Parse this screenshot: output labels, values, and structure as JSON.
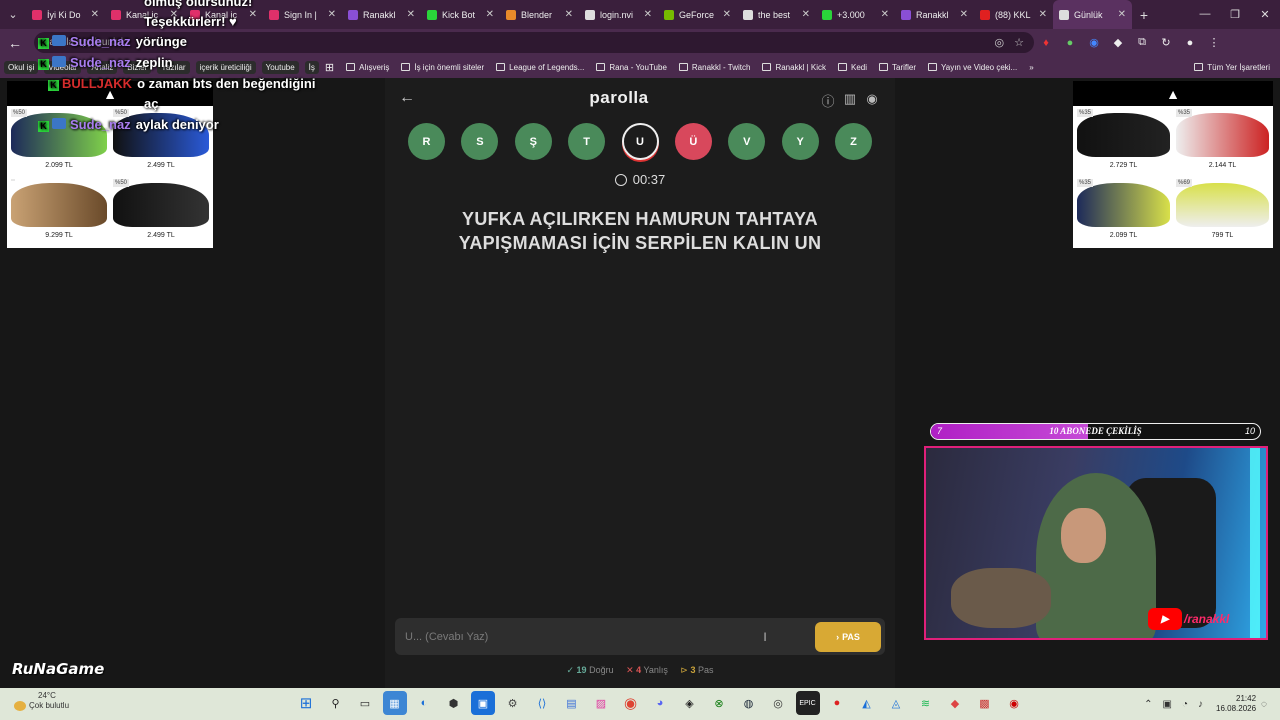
{
  "browser": {
    "tabs": [
      {
        "label": "İyi Ki Do",
        "color": "#e0306a"
      },
      {
        "label": "Kanal iç",
        "color": "#e0306a"
      },
      {
        "label": "Kanal iç",
        "color": "#e0306a"
      },
      {
        "label": "Sign In |",
        "color": "#e0306a"
      },
      {
        "label": "Ranakkl",
        "color": "#8a4fd6"
      },
      {
        "label": "Kick Bot",
        "color": "#2ad43a"
      },
      {
        "label": "Blender",
        "color": "#e88a2a"
      },
      {
        "label": "login.nvi",
        "color": "#dddddd"
      },
      {
        "label": "GeForce",
        "color": "#76b900"
      },
      {
        "label": "the best",
        "color": "#dddddd"
      },
      {
        "label": "+3.000",
        "color": "#2ad43a"
      },
      {
        "label": "Ranakkl",
        "color": "#8a4fd6"
      },
      {
        "label": "(88) KKL",
        "color": "#e02020"
      },
      {
        "label": "Günlük",
        "color": "#dddddd"
      }
    ],
    "address_url": "parolla.app/gunluk",
    "bookmarks_pills": [
      "Okul işi",
      "Videolar",
      "Analiz",
      "Bizler",
      "Yazılar",
      "içerik üreticiliği",
      "Youtube",
      "İş"
    ],
    "bookmarks": [
      "Alışveriş",
      "İş için önemli siteler",
      "League of Legends...",
      "Rana - YouTube",
      "Ranakkl - Twitch",
      "Ranakkl | Kick",
      "Kedi",
      "Tarifler",
      "Yayın ve Video çeki..."
    ],
    "all_bookmarks": "Tüm Yer İşaretleri"
  },
  "chat": [
    {
      "user": "",
      "text": "olmuş olursunuz!"
    },
    {
      "user": "",
      "text": "Teşekkürlerr! ♥"
    },
    {
      "user": "Sude_naz",
      "text": "yörünge"
    },
    {
      "user": "Sude_naz",
      "text": "zeplin"
    },
    {
      "user": "BULLJAKK",
      "text": "o zaman bts den beğendiğini"
    },
    {
      "user": "",
      "text": "aç"
    },
    {
      "user": "Sude_naz",
      "text": "aylak deniyor"
    }
  ],
  "ads": {
    "left": [
      {
        "price": "2.099 TL",
        "disc": "%50"
      },
      {
        "price": "2.499 TL",
        "disc": "%50"
      },
      {
        "price": "9.299 TL",
        "disc": ""
      },
      {
        "price": "2.499 TL",
        "disc": "%50"
      }
    ],
    "right": [
      {
        "price": "2.729 TL",
        "disc": "%35"
      },
      {
        "price": "2.144 TL",
        "disc": "%35"
      },
      {
        "price": "2.099 TL",
        "disc": "%35"
      },
      {
        "price": "799 TL",
        "disc": "%69"
      }
    ]
  },
  "game": {
    "logo": "parolla",
    "letters": [
      {
        "char": "R",
        "state": "pending"
      },
      {
        "char": "S",
        "state": "pending"
      },
      {
        "char": "Ş",
        "state": "pending"
      },
      {
        "char": "T",
        "state": "pending"
      },
      {
        "char": "U",
        "state": "current"
      },
      {
        "char": "Ü",
        "state": "wrong"
      },
      {
        "char": "V",
        "state": "pending"
      },
      {
        "char": "Y",
        "state": "pending"
      },
      {
        "char": "Z",
        "state": "pending"
      }
    ],
    "timer": "00:37",
    "question_line1": "YUFKA AÇILIRKEN HAMURUN TAHTAYA",
    "question_line2": "YAPIŞMAMASI İÇİN SERPİLEN KALIN UN",
    "answer_placeholder": "U... (Cevabı Yaz)",
    "pass_label": "PAS",
    "stats": {
      "correct_count": "19",
      "correct_label": "Doğru",
      "wrong_count": "4",
      "wrong_label": "Yanlış",
      "pass_count": "3",
      "pass_label": "Pas"
    }
  },
  "stream": {
    "goal_label": "10 ABONEDE ÇEKİLİŞ",
    "goal_min": "7",
    "goal_max": "10",
    "goal_fraction": 0.7,
    "yt_handle": "/ranakkl",
    "brand": "RuNaGame"
  },
  "taskbar": {
    "temp": "24°C",
    "weather": "Çok bulutlu",
    "time": "21:42",
    "date": "16.08.2026"
  }
}
